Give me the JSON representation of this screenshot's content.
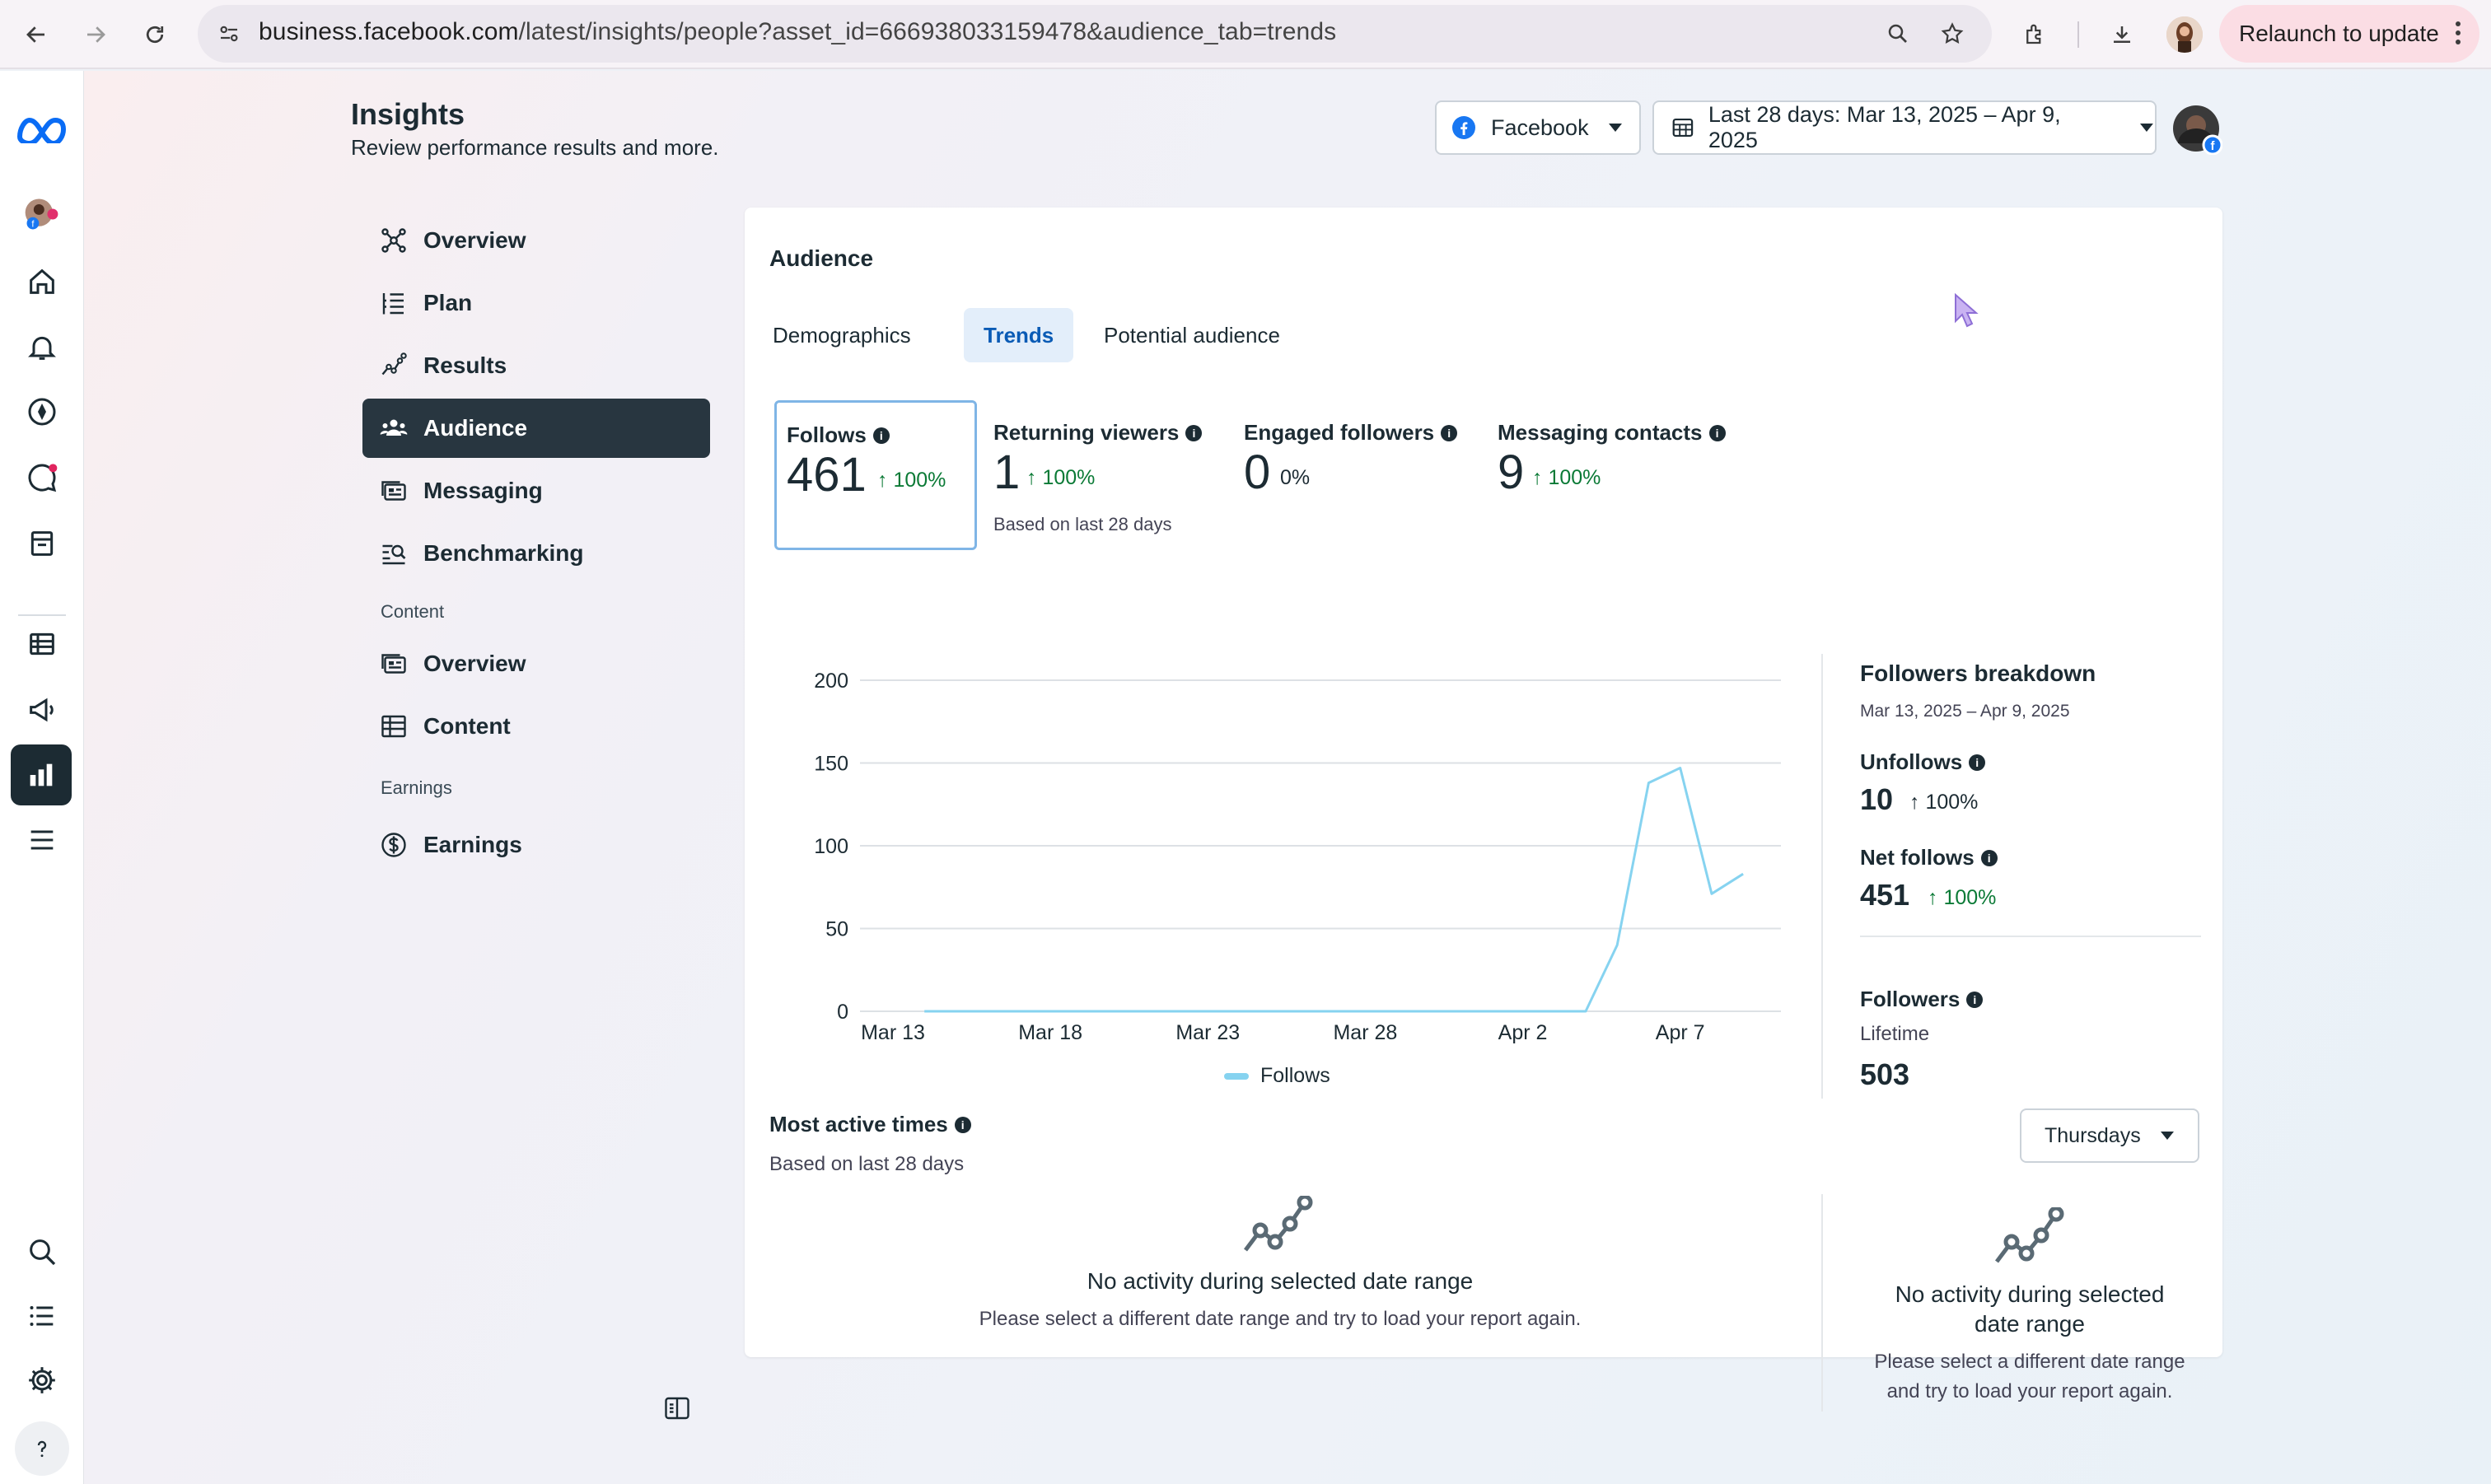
{
  "browser": {
    "url_host": "business.facebook.com",
    "url_path": "/latest/insights/people?asset_id=666938033159478&audience_tab=trends",
    "relaunch_label": "Relaunch to update"
  },
  "header": {
    "title": "Insights",
    "subtitle": "Review performance results and more.",
    "platform_dropdown": "Facebook",
    "date_dropdown": "Last 28 days: Mar 13, 2025 – Apr 9, 2025"
  },
  "sidebar": {
    "items": [
      {
        "label": "Overview",
        "icon": "overview-nodes-icon"
      },
      {
        "label": "Plan",
        "icon": "plan-list-icon"
      },
      {
        "label": "Results",
        "icon": "results-trend-icon"
      },
      {
        "label": "Audience",
        "icon": "audience-people-icon",
        "active": true
      },
      {
        "label": "Messaging",
        "icon": "messaging-icon"
      },
      {
        "label": "Benchmarking",
        "icon": "benchmarking-icon"
      }
    ],
    "content_section": "Content",
    "content_items": [
      {
        "label": "Overview",
        "icon": "content-overview-icon"
      },
      {
        "label": "Content",
        "icon": "content-table-icon"
      }
    ],
    "earnings_section": "Earnings",
    "earnings_items": [
      {
        "label": "Earnings",
        "icon": "dollar-icon"
      }
    ]
  },
  "audience": {
    "title": "Audience",
    "tabs": [
      "Demographics",
      "Trends",
      "Potential audience"
    ],
    "active_tab": "Trends",
    "metrics": [
      {
        "label": "Follows",
        "value": "461",
        "change": "100%"
      },
      {
        "label": "Returning viewers",
        "value": "1",
        "change": "100%",
        "note": "Based on last 28 days"
      },
      {
        "label": "Engaged followers",
        "value": "0",
        "change": "0%"
      },
      {
        "label": "Messaging contacts",
        "value": "9",
        "change": "100%"
      }
    ],
    "legend_label": "Follows",
    "followers_breakdown": {
      "title": "Followers breakdown",
      "range": "Mar 13, 2025 – Apr 9, 2025",
      "unfollows_label": "Unfollows",
      "unfollows_value": "10",
      "unfollows_change": "100%",
      "net_label": "Net follows",
      "net_value": "451",
      "net_change": "100%",
      "followers_label": "Followers",
      "followers_sub": "Lifetime",
      "followers_value": "503"
    },
    "most_active": {
      "title": "Most active times",
      "subtitle": "Based on last 28 days",
      "day_dropdown": "Thursdays",
      "empty_title": "No activity during selected date range",
      "empty_sub": "Please select a different date range and try to load your report again.",
      "empty_title_2a": "No activity during selected",
      "empty_title_2b": "date range",
      "empty_sub_2a": "Please select a different date range",
      "empty_sub_2b": "and try to load your report again."
    }
  },
  "colors": {
    "accent": "#0a5bb5",
    "line": "#86d3f0",
    "positive": "#0b7a36",
    "sidebar_active": "#283640"
  },
  "chart_data": {
    "type": "line",
    "series": [
      {
        "name": "Follows",
        "values": [
          0,
          0,
          0,
          0,
          0,
          0,
          0,
          0,
          0,
          0,
          0,
          0,
          0,
          0,
          0,
          0,
          0,
          0,
          0,
          0,
          0,
          0,
          40,
          138,
          147,
          71,
          83
        ]
      }
    ],
    "x": [
      "Mar 14",
      "Mar 15",
      "Mar 16",
      "Mar 17",
      "Mar 18",
      "Mar 19",
      "Mar 20",
      "Mar 21",
      "Mar 22",
      "Mar 23",
      "Mar 24",
      "Mar 25",
      "Mar 26",
      "Mar 27",
      "Mar 28",
      "Mar 29",
      "Mar 30",
      "Mar 31",
      "Apr 1",
      "Apr 2",
      "Apr 3",
      "Apr 4",
      "Apr 5",
      "Apr 6",
      "Apr 7",
      "Apr 8",
      "Apr 9"
    ],
    "x_tick_labels": [
      "Mar 13",
      "Mar 18",
      "Mar 23",
      "Mar 28",
      "Apr 2",
      "Apr 7"
    ],
    "y_ticks": [
      0,
      50,
      100,
      150,
      200
    ],
    "ylim": [
      0,
      200
    ],
    "grid": true,
    "legend": "bottom-center"
  }
}
